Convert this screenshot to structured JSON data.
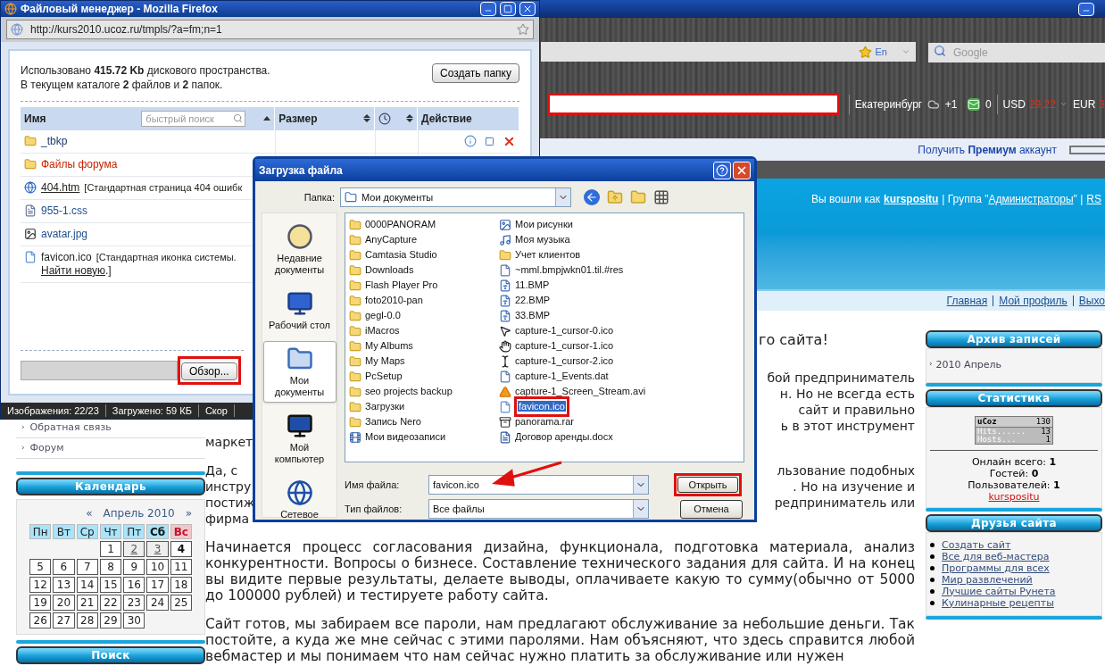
{
  "browser": {
    "lang": "En",
    "search_placeholder": "Google",
    "city": "Екатеринбург",
    "temp": "+1",
    "mail": "0",
    "currency": [
      {
        "code": "USD",
        "rate": "29,22"
      },
      {
        "code": "EUR",
        "rate": "3"
      }
    ]
  },
  "premium": "Получить **Премиум** аккаунт",
  "login": {
    "prefix": "Вы вошли как",
    "user": "kurspositu",
    "group_prefix": "| Группа \"",
    "group": "Администраторы",
    "group_suffix": "\" |",
    "rss": "RS"
  },
  "nav": [
    "Главная",
    "Мой профиль",
    "Выхо"
  ],
  "left_sidebar": {
    "menu": [
      {
        "marker": "›",
        "label": "Обратная связь"
      },
      {
        "marker": "›",
        "label": "Форум"
      }
    ],
    "calendar": {
      "title": "Календарь",
      "prev": "«",
      "month": "Апрель 2010",
      "next": "»",
      "weekdays": [
        {
          "label": "Пн",
          "kind": "weekday"
        },
        {
          "label": "Вт",
          "kind": "weekday"
        },
        {
          "label": "Ср",
          "kind": "weekday"
        },
        {
          "label": "Чт",
          "kind": "weekday"
        },
        {
          "label": "Пт",
          "kind": "weekday"
        },
        {
          "label": "Сб",
          "kind": "saturday"
        },
        {
          "label": "Вс",
          "kind": "sunday"
        }
      ],
      "weeks": [
        [
          {
            "label": "1",
            "kind": "day"
          },
          {
            "label": "2",
            "kind": "link"
          },
          {
            "label": "3",
            "kind": "link"
          },
          {
            "label": "4",
            "kind": "today"
          }
        ],
        [
          {
            "label": "5",
            "kind": "day"
          },
          {
            "label": "6",
            "kind": "day"
          },
          {
            "label": "7",
            "kind": "day"
          },
          {
            "label": "8",
            "kind": "day"
          },
          {
            "label": "9",
            "kind": "day"
          },
          {
            "label": "10",
            "kind": "day"
          },
          {
            "label": "11",
            "kind": "day"
          }
        ],
        [
          {
            "label": "12",
            "kind": "day"
          },
          {
            "label": "13",
            "kind": "day"
          },
          {
            "label": "14",
            "kind": "day"
          },
          {
            "label": "15",
            "kind": "day"
          },
          {
            "label": "16",
            "kind": "day"
          },
          {
            "label": "17",
            "kind": "day"
          },
          {
            "label": "18",
            "kind": "day"
          }
        ],
        [
          {
            "label": "19",
            "kind": "day"
          },
          {
            "label": "20",
            "kind": "day"
          },
          {
            "label": "21",
            "kind": "day"
          },
          {
            "label": "22",
            "kind": "day"
          },
          {
            "label": "23",
            "kind": "day"
          },
          {
            "label": "24",
            "kind": "day"
          },
          {
            "label": "25",
            "kind": "day"
          }
        ],
        [
          {
            "label": "26",
            "kind": "day"
          },
          {
            "label": "27",
            "kind": "day"
          },
          {
            "label": "28",
            "kind": "day"
          },
          {
            "label": "29",
            "kind": "day"
          },
          {
            "label": "30",
            "kind": "day"
          }
        ]
      ]
    },
    "search_title": "Поиск"
  },
  "article": {
    "heading": "го сайта!",
    "covered_paragraphs": [
      [
        {
          "right": "бой предприниматель"
        },
        {
          "right": "н.  Но не всегда есть"
        },
        {
          "right": "сайт и правильно"
        },
        {
          "right": "ь в этот инструмент"
        },
        {
          "left": "маркет"
        }
      ],
      [
        {
          "left": "Да, с",
          "right": "льзование подобных"
        },
        {
          "left": "инстру",
          "right": ". Но на изучение и"
        },
        {
          "left": "постиж",
          "right": "редприниматель или"
        },
        {
          "left": "фирма"
        }
      ]
    ],
    "paragraphs": [
      "Начинается процесс согласования дизайна, функционала, подготовка материала, анализ конкурентности.  Вопросы о бизнесе.  Составление технического задания для сайта.  И на конец  вы видите первые результаты, делаете выводы, оплачиваете какую то сумму(обычно от 5000 до 100000 рублей) и тестируете работу сайта.",
      "Сайт готов, мы забираем все пароли, нам предлагают обслуживание за небольшие деньги. Так постойте, а куда же мне сейчас с этими паролями. Нам объясняют, что здесь справится любой вебмастер и мы понимаем что нам сейчас нужно платить за обслуживание или нужен"
    ]
  },
  "right_sidebar": {
    "archive": {
      "title": "Архив записей",
      "items": [
        {
          "marker": "›",
          "label": "2010 Апрель"
        }
      ]
    },
    "stats": {
      "title": "Статистика",
      "counter": {
        "brand": "uCoz",
        "total": "130",
        "rows": [
          {
            "label": "Hits......",
            "value": "13"
          },
          {
            "label": "Hosts...",
            "value": "1"
          }
        ]
      },
      "lines": [
        {
          "label": "Онлайн всего:",
          "value": "1"
        },
        {
          "label": "Гостей:",
          "value": "0"
        },
        {
          "label": "Пользователей:",
          "value": "1"
        }
      ],
      "user": "kurspositu"
    },
    "friends": {
      "title": "Друзья сайта",
      "links": [
        "Создать сайт",
        "Все для веб-мастера",
        "Программы для всех",
        "Мир развлечений",
        "Лучшие сайты Рунета",
        "Кулинарные рецепты"
      ]
    }
  },
  "firefox": {
    "title": "Файловый менеджер - Mozilla Firefox",
    "url": "http://kurs2010.ucoz.ru/tmpls/?a=fm;n=1",
    "usage": "Использовано **415.72 Kb** дискового пространства.",
    "counts": "В текущем каталоге **2** файлов и **2** папок.",
    "create_button": "Создать папку",
    "columns": [
      {
        "label": "Имя",
        "kind": "name"
      },
      {
        "label": "Размер",
        "kind": "size"
      },
      {
        "kind": "date"
      },
      {
        "label": "Действие",
        "kind": "action"
      }
    ],
    "quick_search": {
      "placeholder": "быстрый поиск"
    },
    "files": [
      {
        "name": "_tbkp",
        "kind": "folder",
        "color": "#1a3c6e",
        "underline": false,
        "actions": true
      },
      {
        "name": "Файлы форума",
        "kind": "folder",
        "color": "#cc2200",
        "underline": false
      },
      {
        "name": "404.htm",
        "kind": "html",
        "color": "#222222",
        "underline": true,
        "note": "[Стандартная страница 404 ошибк"
      },
      {
        "name": "955-1.css",
        "kind": "css",
        "color": "#1f4e8c",
        "underline": false
      },
      {
        "name": "avatar.jpg",
        "kind": "image",
        "color": "#1f4e8c",
        "underline": false
      },
      {
        "name": "favicon.ico",
        "kind": "ico",
        "color": "#222222",
        "underline": false,
        "note": "[Стандартная иконка системы.",
        "link": "Найти новую",
        "after": ".]"
      }
    ],
    "browse_button": "Обзор...",
    "status": [
      "Изображения: 22/23",
      "Загружено: 59 КБ",
      "Скор"
    ]
  },
  "dialog": {
    "title": "Загрузка файла",
    "folder_label": "Папка:",
    "folder": "Мои документы",
    "places": [
      {
        "label": "Недавние документы",
        "kind": "recent",
        "selected": false
      },
      {
        "label": "Рабочий стол",
        "kind": "desktop",
        "selected": false
      },
      {
        "label": "Мои документы",
        "kind": "documents",
        "selected": true
      },
      {
        "label": "Мой компьютер",
        "kind": "computer",
        "selected": false
      },
      {
        "label": "Сетевое",
        "kind": "network",
        "selected": false
      }
    ],
    "files": [
      {
        "name": "0000PANORAM",
        "kind": "folder",
        "selected": false
      },
      {
        "name": "AnyCapture",
        "kind": "folder",
        "selected": false
      },
      {
        "name": "Camtasia Studio",
        "kind": "folder",
        "selected": false
      },
      {
        "name": "Downloads",
        "kind": "folder",
        "selected": false
      },
      {
        "name": "Flash Player Pro",
        "kind": "folder",
        "selected": false
      },
      {
        "name": "foto2010-pan",
        "kind": "folder",
        "selected": false
      },
      {
        "name": "gegl-0.0",
        "kind": "folder",
        "selected": false
      },
      {
        "name": "iMacros",
        "kind": "folder",
        "selected": false
      },
      {
        "name": "My Albums",
        "kind": "folder",
        "selected": false
      },
      {
        "name": "My Maps",
        "kind": "folder",
        "selected": false
      },
      {
        "name": "PcSetup",
        "kind": "folder",
        "selected": false
      },
      {
        "name": "seo projects backup",
        "kind": "folder",
        "selected": false
      },
      {
        "name": "Загрузки",
        "kind": "folder",
        "selected": false
      },
      {
        "name": "Запись Nero",
        "kind": "folder",
        "selected": false
      },
      {
        "name": "Мои видеозаписи",
        "kind": "video",
        "selected": false
      },
      {
        "name": "Мои рисунки",
        "kind": "pictures",
        "selected": false
      },
      {
        "name": "Моя музыка",
        "kind": "music",
        "selected": false
      },
      {
        "name": "Учет клиентов",
        "kind": "folder",
        "selected": false
      },
      {
        "name": "~mml.bmpjwkn01.til.#res",
        "kind": "generic",
        "selected": false
      },
      {
        "name": "11.BMP",
        "kind": "bmp",
        "selected": false
      },
      {
        "name": "22.BMP",
        "kind": "bmp",
        "selected": false
      },
      {
        "name": "33.BMP",
        "kind": "bmp",
        "selected": false
      },
      {
        "name": "capture-1_cursor-0.ico",
        "kind": "arrow",
        "selected": false
      },
      {
        "name": "capture-1_cursor-1.ico",
        "kind": "hand",
        "selected": false
      },
      {
        "name": "capture-1_cursor-2.ico",
        "kind": "ibeam",
        "selected": false
      },
      {
        "name": "capture-1_Events.dat",
        "kind": "generic",
        "selected": false
      },
      {
        "name": "capture-1_Screen_Stream.avi",
        "kind": "cone",
        "selected": false
      },
      {
        "name": "favicon.ico",
        "kind": "ico",
        "selected": true
      },
      {
        "name": "panorama.rar",
        "kind": "rar",
        "selected": false
      },
      {
        "name": "Договор аренды.docx",
        "kind": "doc",
        "selected": false
      }
    ],
    "filename_label": "Имя файла:",
    "filename": "favicon.ico",
    "type_label": "Тип файлов:",
    "type": "Все файлы",
    "open_button": "Открыть",
    "cancel_button": "Отмена"
  }
}
